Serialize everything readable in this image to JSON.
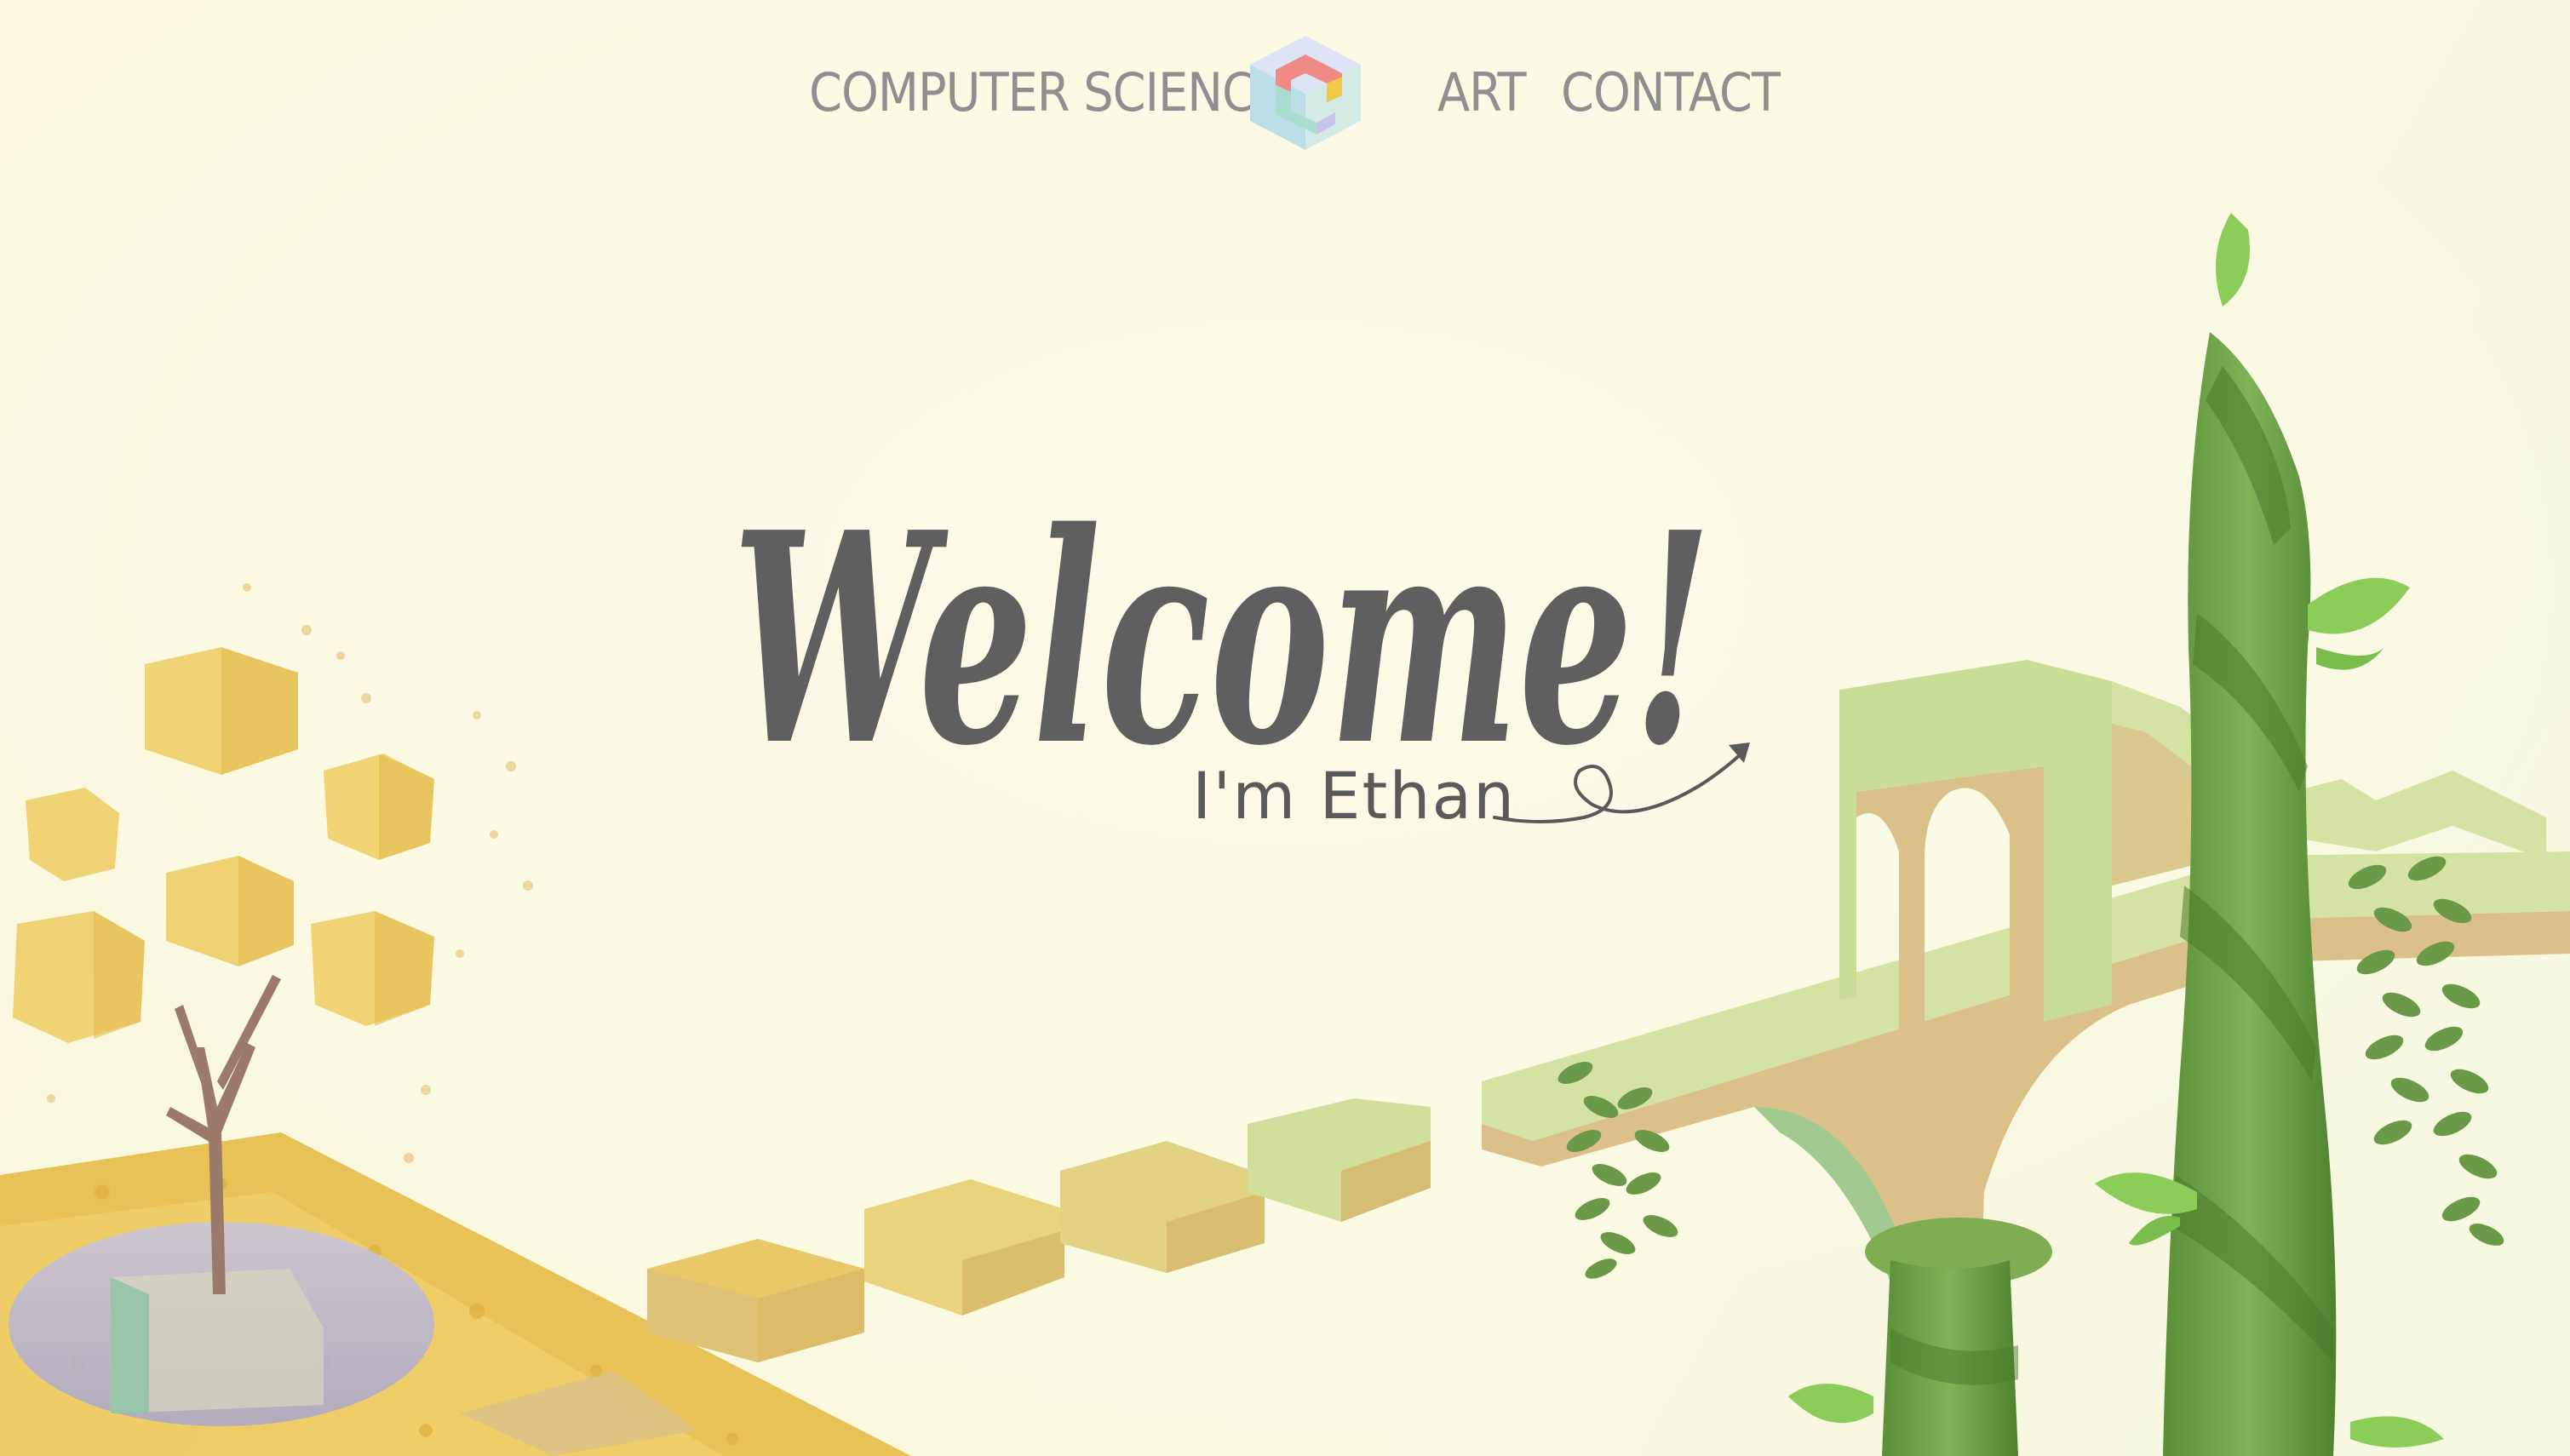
{
  "nav": {
    "links": [
      {
        "id": "computer-science",
        "label": "COMPUTER SCIENCE"
      },
      {
        "id": "art",
        "label": "ART"
      },
      {
        "id": "contact",
        "label": "CONTACT"
      }
    ],
    "logo_icon": "cube-logo-icon"
  },
  "hero": {
    "heading": "Welcome!",
    "subtitle": "I'm Ethan"
  },
  "colors": {
    "background": "#fbf8df",
    "nav_text": "#8f8f8f",
    "heading_text": "#5f5f5f",
    "foliage_green": "#6fa64a",
    "autumn_yellow": "#e8c65b",
    "bridge_tan": "#dcc08a",
    "pond_blue": "#b9b6d8"
  }
}
